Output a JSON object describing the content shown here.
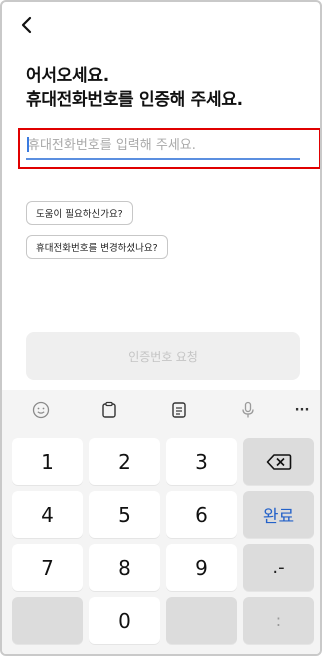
{
  "header": {
    "back_icon": "chevron-left-icon"
  },
  "title": {
    "line1": "어서오세요.",
    "line2": "휴대전화번호를 인증해 주세요."
  },
  "phone_input": {
    "placeholder": "휴대전화번호를 입력해 주세요.",
    "value": ""
  },
  "links": {
    "help": "도움이 필요하신가요?",
    "change_number": "휴대전화번호를 변경하셨나요?"
  },
  "request_button": {
    "label": "인증번호 요청"
  },
  "keyboard": {
    "toolbar": [
      "emoji-icon",
      "clipboard-icon",
      "notes-icon",
      "microphone-icon",
      "more-icon"
    ],
    "more_label": "···",
    "keys": {
      "k1": "1",
      "k2": "2",
      "k3": "3",
      "k4": "4",
      "k5": "5",
      "k6": "6",
      "k7": "7",
      "k8": "8",
      "k9": "9",
      "k0": "0",
      "done": "완료",
      "dot_dash": ".-",
      "colon": ":"
    }
  },
  "colors": {
    "accent": "#5b8fe0",
    "done_text": "#2462c9",
    "highlight": "#e00000",
    "disabled_button": "#efefef"
  }
}
